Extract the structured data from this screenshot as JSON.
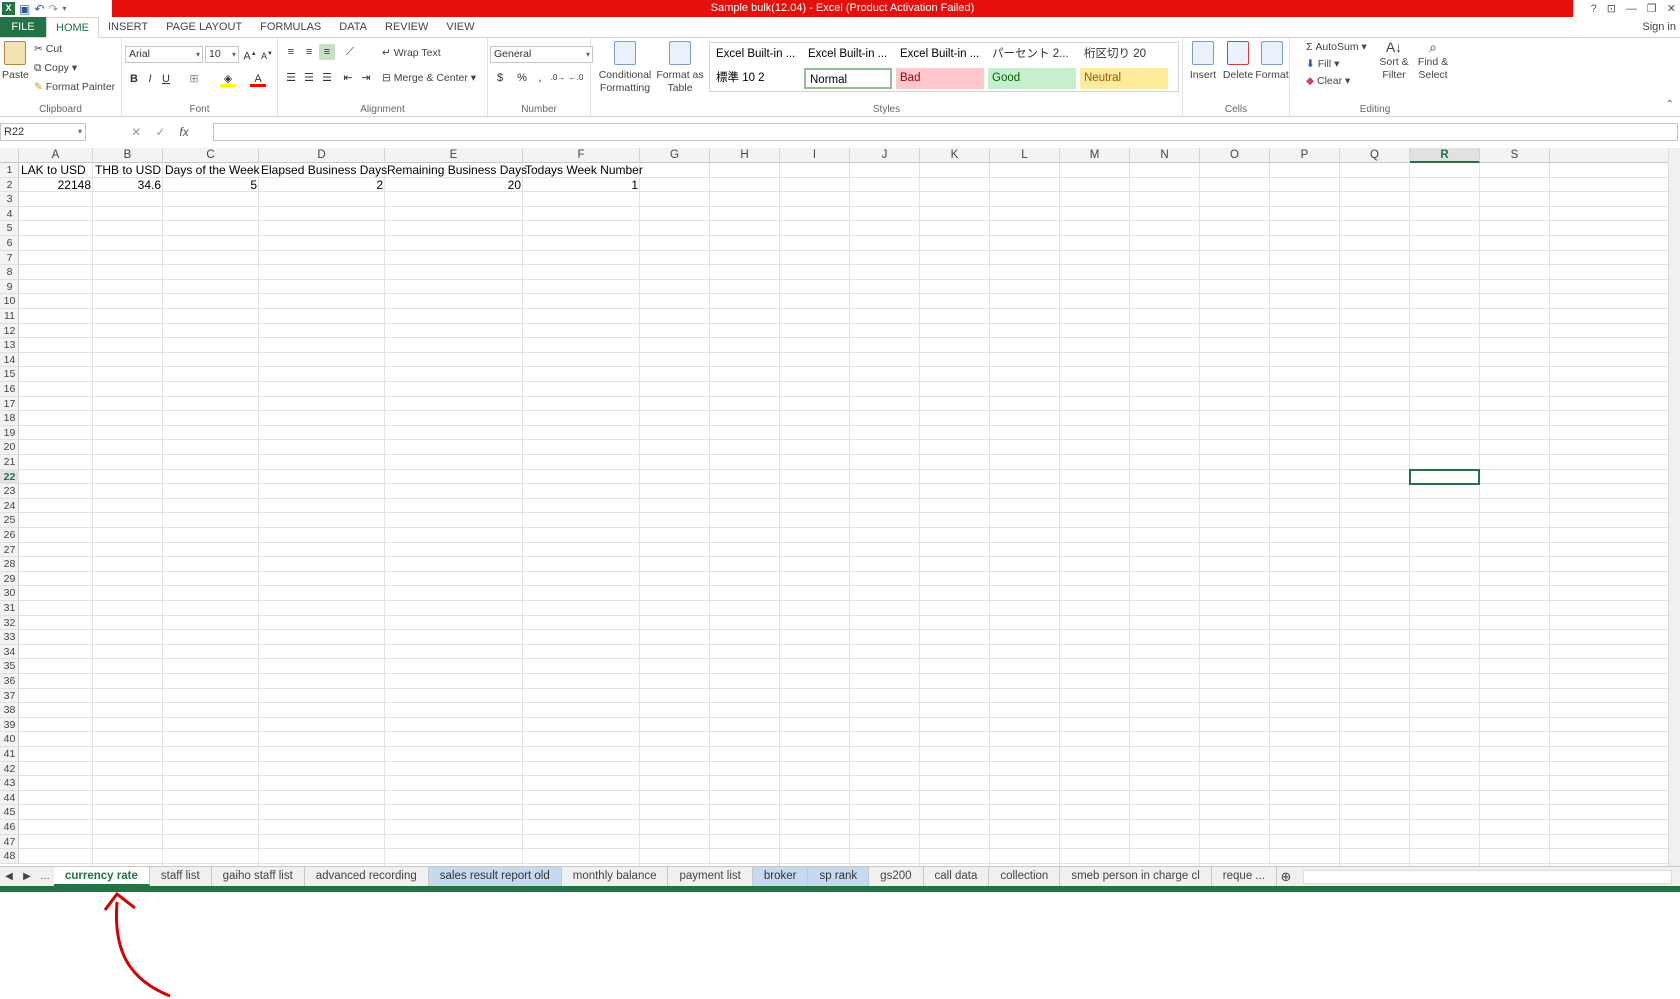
{
  "window": {
    "title": "Sample bulk(12.04) - Excel (Product Activation Failed)",
    "sign_in": "Sign in"
  },
  "ribbon_tabs": [
    "FILE",
    "HOME",
    "INSERT",
    "PAGE LAYOUT",
    "FORMULAS",
    "DATA",
    "REVIEW",
    "VIEW"
  ],
  "clipboard": {
    "paste": "Paste",
    "cut": "Cut",
    "copy": "Copy",
    "format_painter": "Format Painter",
    "label": "Clipboard"
  },
  "font": {
    "name": "Arial",
    "size": "10",
    "label": "Font"
  },
  "alignment": {
    "wrap": "Wrap Text",
    "merge": "Merge & Center",
    "label": "Alignment"
  },
  "number": {
    "format": "General",
    "label": "Number"
  },
  "styles": {
    "conditional": "Conditional Formatting",
    "format_table": "Format as Table",
    "label": "Styles",
    "cells": [
      {
        "text": "Excel Built-in ...",
        "bg": "#ffffff",
        "color": "#000000"
      },
      {
        "text": "Excel Built-in ...",
        "bg": "#ffffff",
        "color": "#000000"
      },
      {
        "text": "Excel Built-in ...",
        "bg": "#ffffff",
        "color": "#000000"
      },
      {
        "text": "パーセント 2...",
        "bg": "#ffffff",
        "color": "#333333"
      },
      {
        "text": "桁区切り 20",
        "bg": "#ffffff",
        "color": "#333333"
      },
      {
        "text": "標準 10 2",
        "bg": "#ffffff",
        "color": "#000000"
      },
      {
        "text": "Normal",
        "bg": "#ffffff",
        "color": "#000000"
      },
      {
        "text": "Bad",
        "bg": "#ffc7ce",
        "color": "#9c0006"
      },
      {
        "text": "Good",
        "bg": "#c6efce",
        "color": "#006100"
      },
      {
        "text": "Neutral",
        "bg": "#ffeb9c",
        "color": "#9c5700"
      }
    ]
  },
  "cells_group": {
    "insert": "Insert",
    "delete": "Delete",
    "format": "Format",
    "label": "Cells"
  },
  "editing": {
    "autosum": "AutoSum",
    "fill": "Fill",
    "clear": "Clear",
    "sort": "Sort & Filter",
    "find": "Find & Select",
    "label": "Editing"
  },
  "formula_bar": {
    "name_box": "R22",
    "formula": ""
  },
  "columns": [
    "A",
    "B",
    "C",
    "D",
    "E",
    "F",
    "G",
    "H",
    "I",
    "J",
    "K",
    "L",
    "M",
    "N",
    "O",
    "P",
    "Q",
    "R",
    "S"
  ],
  "selected_column": "R",
  "selected_row": 22,
  "row_count": 48,
  "headers": [
    "LAK to USD",
    "THB to USD",
    "Days of the Week",
    "Elapsed Business Days",
    "Remaining Business Days",
    "Todays Week Number"
  ],
  "values": [
    "22148",
    "34.6",
    "5",
    "2",
    "20",
    "1"
  ],
  "sheet_tabs": [
    {
      "name": "currency rate",
      "state": "active"
    },
    {
      "name": "staff list",
      "state": ""
    },
    {
      "name": "gaiho staff list",
      "state": ""
    },
    {
      "name": "advanced recording",
      "state": ""
    },
    {
      "name": "sales result report old",
      "state": "grouped"
    },
    {
      "name": "monthly balance",
      "state": ""
    },
    {
      "name": "payment list",
      "state": ""
    },
    {
      "name": "broker",
      "state": "grouped"
    },
    {
      "name": "sp rank",
      "state": "grouped"
    },
    {
      "name": "gs200",
      "state": ""
    },
    {
      "name": "call data",
      "state": ""
    },
    {
      "name": "collection",
      "state": ""
    },
    {
      "name": "smeb person in charge cl",
      "state": ""
    },
    {
      "name": "reque ...",
      "state": ""
    }
  ],
  "accent": "#217346"
}
